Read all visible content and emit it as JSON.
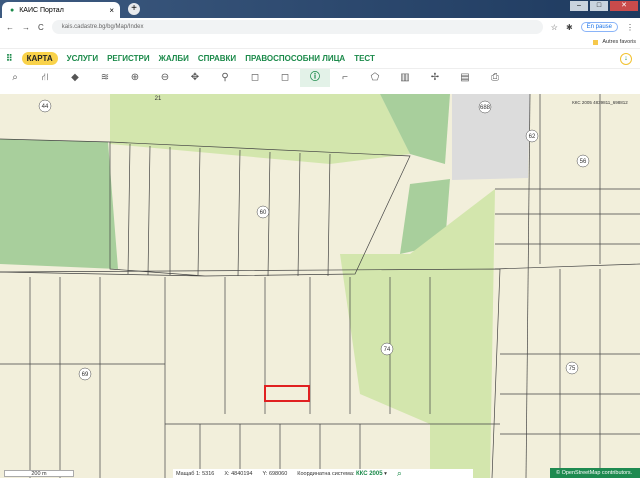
{
  "browser": {
    "tab_title": "КАИС Портал",
    "url": "kais.cadastre.bg/bg/Map/Index",
    "profile": "En pause",
    "bookmarks_folder": "Autres favoris"
  },
  "nav": {
    "items": [
      "КАРТА",
      "УСЛУГИ",
      "РЕГИСТРИ",
      "ЖАЛБИ",
      "СПРАВКИ",
      "ПРАВОСПОСОБНИ ЛИЦА",
      "ТЕСТ"
    ]
  },
  "toolbar": {
    "icons": [
      "search-icon",
      "tree-icon",
      "layers-icon",
      "stack-icon",
      "zoom-in-icon",
      "zoom-out-icon",
      "pan-icon",
      "pin-icon",
      "select-rect-add-icon",
      "select-rect-remove-icon",
      "info-icon",
      "polyline-icon",
      "polygon-icon",
      "book-icon",
      "measure-icon",
      "document-icon",
      "print-icon"
    ],
    "active": "info-icon"
  },
  "map": {
    "labels": [
      "44",
      "21",
      "688",
      "62",
      "56",
      "60",
      "74",
      "69",
      "75"
    ],
    "coordinate_note": "ККС 2005 4839811_698812",
    "colors": {
      "land": "#f2efdb",
      "green": "#d3e6ad",
      "forest": "#a8cf9c",
      "urban": "#dcdcdc",
      "highlight": "#e02020"
    }
  },
  "status": {
    "scale_bar": "200 m",
    "scale_label": "Мащаб 1:",
    "scale_value": "5316",
    "x_label": "X:",
    "x_value": "4840194",
    "y_label": "Y:",
    "y_value": "698060",
    "cs_label": "Координатна система:",
    "cs_value": "ККС 2005",
    "attribution": "© OpenStreetMap contributors."
  }
}
